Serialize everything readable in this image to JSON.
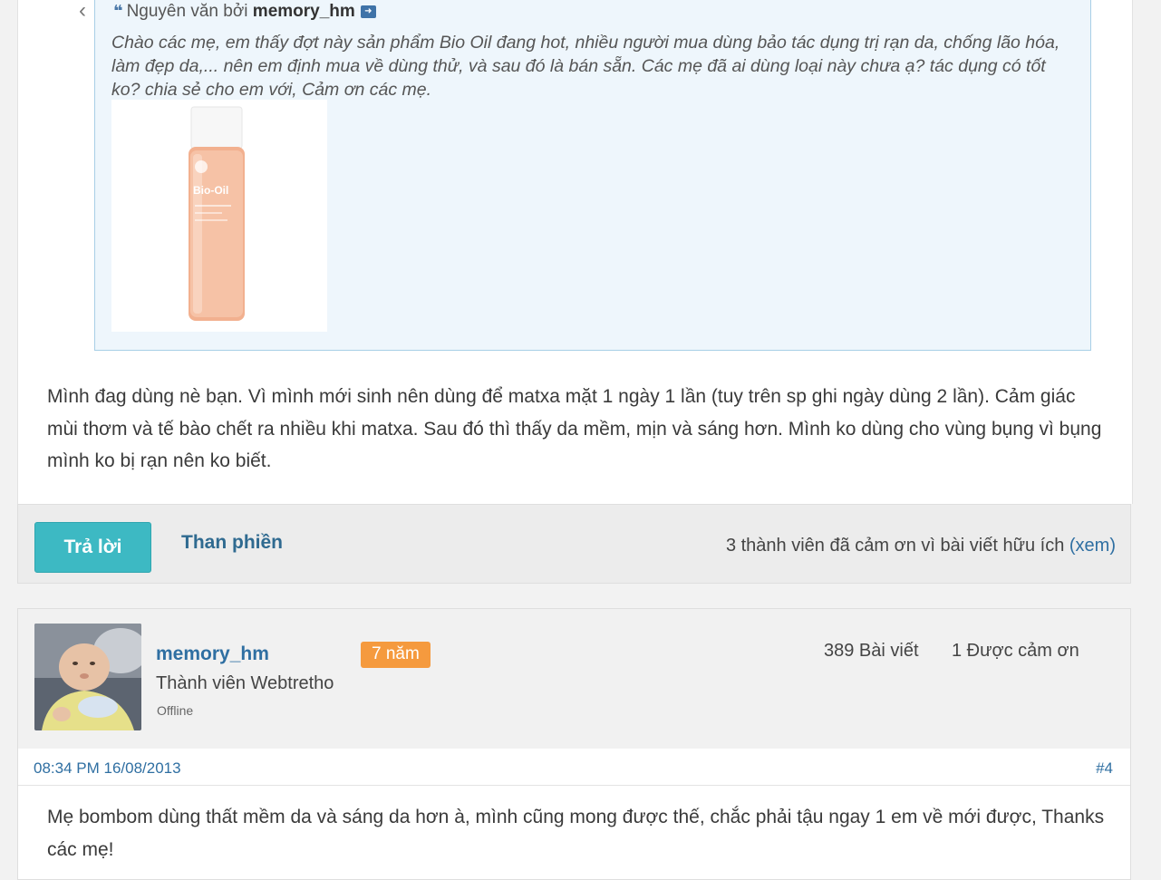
{
  "quote": {
    "prefix": "Nguyên văn bởi",
    "author": "memory_hm",
    "text": "Chào các mẹ, em thấy đợt này sản phẩm Bio Oil đang hot, nhiều người mua dùng bảo tác dụng trị rạn da, chống lão hóa, làm đẹp da,... nên em định mua về dùng thử, và sau đó là bán sẵn. Các mẹ đã ai dùng loại này chưa ạ? tác dụng có tốt ko? chia sẻ cho em với, Cảm ơn các mẹ.",
    "product_image_brand": "Bio-Oil"
  },
  "post": {
    "text": "Mình đag dùng nè bạn. Vì mình mới sinh nên dùng để matxa mặt 1 ngày 1 lần (tuy trên sp ghi ngày dùng 2 lần). Cảm giác mùi thơm và tế bào chết ra nhiều khi matxa. Sau đó thì thấy da mềm, mịn và sáng hơn. Mình ko dùng cho vùng bụng vì bụng mình ko bị rạn nên ko biết."
  },
  "actions": {
    "reply_label": "Trả lời",
    "complain_label": "Than phiền",
    "thanks_text": "3 thành viên đã cảm ơn vì bài viết hữu ích",
    "view_link": "(xem)"
  },
  "post2": {
    "username": "memory_hm",
    "badge": "7 năm",
    "member_title": "Thành viên Webtretho",
    "status": "Offline",
    "post_count": "389 Bài viết",
    "thanks_count": "1 Được cảm ơn",
    "date": "08:34 PM 16/08/2013",
    "number": "#4",
    "text": "Mẹ bombom dùng thất mềm da và sáng da hơn à, mình cũng mong được thế, chắc phải tậu ngay 1 em về mới được, Thanks các mẹ!"
  },
  "icons": {
    "quote": "quote-icon",
    "view_post": "arrow-right-icon",
    "back": "chevron-left-icon"
  },
  "colors": {
    "accent": "#3db9c3",
    "link": "#2f6fa2",
    "badge": "#f59a3e",
    "quote_bg": "#eef6fc",
    "quote_border": "#a8cfe6"
  }
}
